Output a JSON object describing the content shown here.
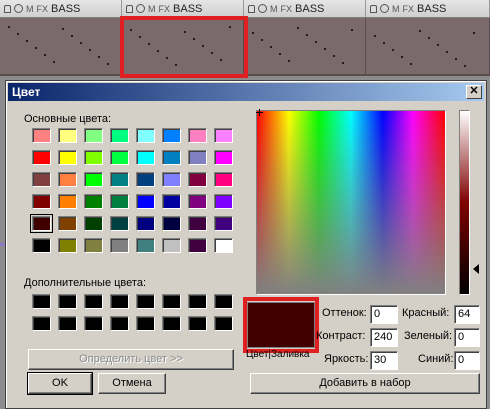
{
  "daw": {
    "clips": [
      {
        "m": "M",
        "fx": "FX",
        "name": "BASS"
      },
      {
        "m": "M",
        "fx": "FX",
        "name": "BASS"
      },
      {
        "m": "M",
        "fx": "FX",
        "name": "BASS"
      },
      {
        "m": "M",
        "fx": "FX",
        "name": "BASS"
      }
    ]
  },
  "dialog": {
    "title": "Цвет",
    "close_label": "✕",
    "basic_colors_label": "Основные цвета:",
    "basic_colors": [
      "#ff8080",
      "#ffff80",
      "#80ff80",
      "#00ff80",
      "#80ffff",
      "#0080ff",
      "#ff80c0",
      "#ff80ff",
      "#ff0000",
      "#ffff00",
      "#80ff00",
      "#00ff40",
      "#00ffff",
      "#0080c0",
      "#8080c0",
      "#ff00ff",
      "#804040",
      "#ff8040",
      "#00ff00",
      "#008080",
      "#004080",
      "#8080ff",
      "#800040",
      "#ff0080",
      "#800000",
      "#ff8000",
      "#008000",
      "#008040",
      "#0000ff",
      "#0000a0",
      "#800080",
      "#8000ff",
      "#400000",
      "#804000",
      "#004000",
      "#004040",
      "#000080",
      "#000040",
      "#400040",
      "#400080",
      "#000000",
      "#808000",
      "#808040",
      "#808080",
      "#408080",
      "#c0c0c0",
      "#400040",
      "#ffffff"
    ],
    "custom_colors_label": "Дополнительные цвета:",
    "custom_colors": [
      "#000000",
      "#000000",
      "#000000",
      "#000000",
      "#000000",
      "#000000",
      "#000000",
      "#000000",
      "#000000",
      "#000000",
      "#000000",
      "#000000",
      "#000000",
      "#000000",
      "#000000",
      "#000000"
    ],
    "define_custom_button": "Определить цвет >>",
    "ok_button": "OK",
    "cancel_button": "Отмена",
    "add_to_custom_button": "Добавить в набор",
    "preview_color": "#400000",
    "color_solid_label": "Цвет|Заливка",
    "fields": {
      "hue": {
        "label": "Оттенок:",
        "value": "0"
      },
      "sat": {
        "label": "Контраст:",
        "value": "240"
      },
      "lum": {
        "label": "Яркость:",
        "value": "30"
      },
      "red": {
        "label": "Красный:",
        "value": "64"
      },
      "green": {
        "label": "Зеленый:",
        "value": "0"
      },
      "blue": {
        "label": "Синий:",
        "value": "0"
      }
    }
  },
  "colors": {
    "highlight": "#e02020",
    "titlebar_start": "#0a246a",
    "titlebar_end": "#a6caf0",
    "dialog_face": "#d4d0c8"
  }
}
